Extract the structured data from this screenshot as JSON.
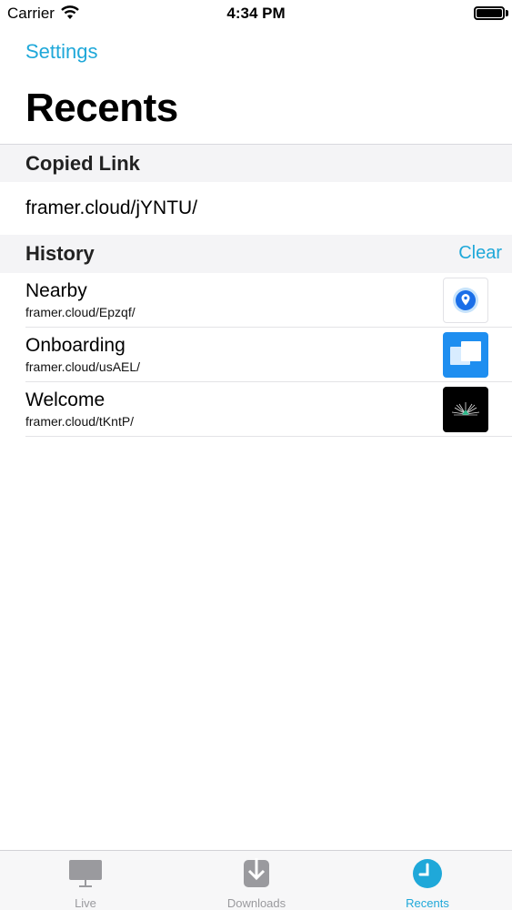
{
  "status_bar": {
    "carrier": "Carrier",
    "time": "4:34 PM"
  },
  "nav": {
    "back_label": "Settings",
    "title": "Recents"
  },
  "copied_section": {
    "header": "Copied Link",
    "link": "framer.cloud/jYNTU/"
  },
  "history_section": {
    "header": "History",
    "clear_label": "Clear",
    "items": [
      {
        "title": "Nearby",
        "url": "framer.cloud/Epzqf/",
        "thumb_icon": "location-pin-icon"
      },
      {
        "title": "Onboarding",
        "url": "framer.cloud/usAEL/",
        "thumb_icon": "windows-icon"
      },
      {
        "title": "Welcome",
        "url": "framer.cloud/tKntP/",
        "thumb_icon": "sunrise-icon"
      }
    ]
  },
  "tab_bar": {
    "tabs": [
      {
        "label": "Live",
        "icon": "monitor-icon",
        "active": false
      },
      {
        "label": "Downloads",
        "icon": "download-icon",
        "active": false
      },
      {
        "label": "Recents",
        "icon": "clock-icon",
        "active": true
      }
    ]
  },
  "colors": {
    "accent": "#1fa8d9",
    "inactive": "#9a9a9e",
    "section_bg": "#f4f4f6"
  }
}
